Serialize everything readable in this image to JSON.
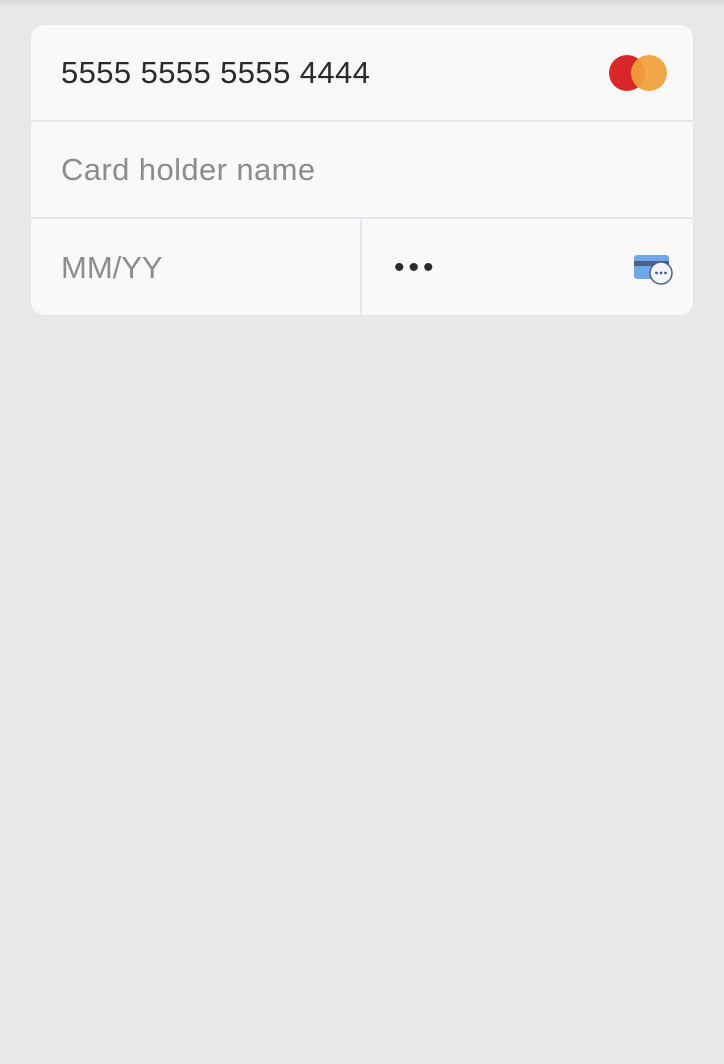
{
  "card_form": {
    "card_number": {
      "value": "5555  5555  5555  4444",
      "brand_icon": "mastercard-logo-icon",
      "brand_colors": [
        "#d9282a",
        "#f0a03a"
      ]
    },
    "card_holder": {
      "placeholder": "Card holder name"
    },
    "expiry": {
      "placeholder": "MM/YY"
    },
    "cvc": {
      "value": "•••",
      "icon": "card-cvc-icon"
    }
  },
  "colors": {
    "background": "#e8e8e8",
    "form_background": "#f9f9fa",
    "divider": "#e6e6ef",
    "text": "#2a2a2a",
    "placeholder": "#8c8c8c"
  }
}
